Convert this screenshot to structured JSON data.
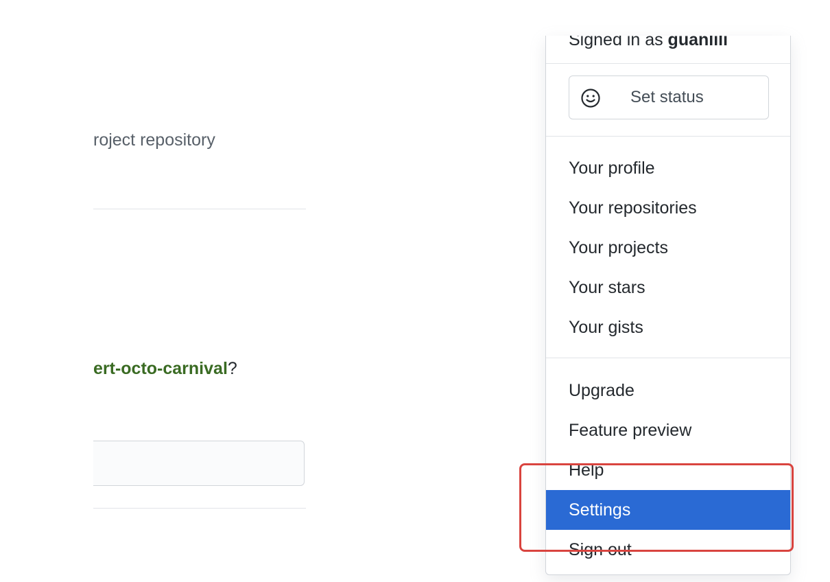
{
  "background": {
    "repo_description": "roject repository",
    "confirm_prefix": "ert-octo-carnival",
    "confirm_suffix": "?",
    "confirm_input_value": ""
  },
  "dropdown": {
    "signed_in_prefix": "Signed in as ",
    "username": "guanlili",
    "set_status_label": "Set status",
    "set_status_icon": "smiley-icon",
    "section_profile": [
      {
        "label": "Your profile"
      },
      {
        "label": "Your repositories"
      },
      {
        "label": "Your projects"
      },
      {
        "label": "Your stars"
      },
      {
        "label": "Your gists"
      }
    ],
    "section_account": [
      {
        "label": "Upgrade"
      },
      {
        "label": "Feature preview"
      },
      {
        "label": "Help"
      },
      {
        "label": "Settings",
        "active": true
      },
      {
        "label": "Sign out"
      }
    ]
  },
  "colors": {
    "active_item_bg": "#2a6ad4",
    "repo_link": "#3a6b23",
    "highlight_border": "#d9443f"
  }
}
